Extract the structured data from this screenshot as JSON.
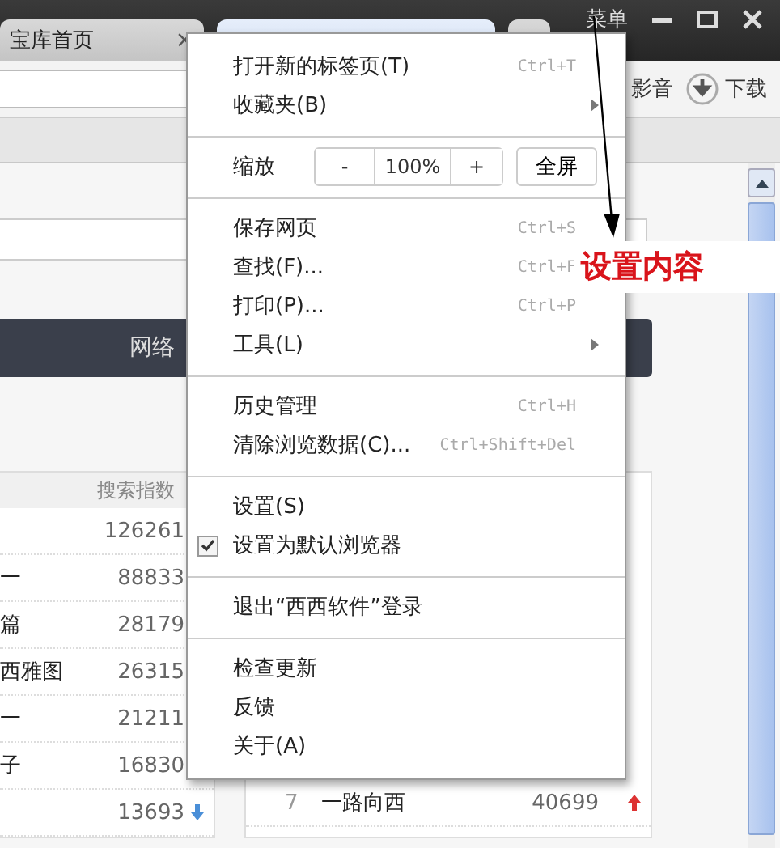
{
  "tabs": [
    {
      "title": "宝库首页",
      "close": "×",
      "selected": false
    },
    {
      "selected": true
    },
    {
      "selected": false
    }
  ],
  "menu_button": "菜单",
  "toolbar": {
    "links": [
      {
        "label": "影音",
        "kind": "text"
      },
      {
        "label": "下载",
        "kind": "download"
      }
    ]
  },
  "page": {
    "nav_bar": {
      "items": [
        "网络"
      ]
    },
    "left_table": {
      "header": "搜索指数",
      "rows": [
        {
          "name": "",
          "value": "126261"
        },
        {
          "name": "一",
          "value": "88833"
        },
        {
          "name": "篇",
          "value": "28179"
        },
        {
          "name": "西雅图",
          "value": "26315"
        },
        {
          "name": "一",
          "value": "21211"
        },
        {
          "name": "子",
          "value": "16830"
        },
        {
          "name": "",
          "value": "13693",
          "rising": false
        }
      ]
    },
    "right_table": {
      "rows": [
        {
          "rank": "7",
          "name": "一路向西",
          "value": "40699",
          "rising": true
        }
      ]
    }
  },
  "menu": {
    "items": [
      {
        "kind": "item",
        "label": "打开新的标签页(T)",
        "shortcut": "Ctrl+T"
      },
      {
        "kind": "submenu",
        "label": "收藏夹(B)"
      },
      {
        "kind": "separator"
      },
      {
        "kind": "zoom",
        "label": "缩放",
        "minus": "-",
        "value": "100%",
        "plus": "+",
        "fullscreen": "全屏"
      },
      {
        "kind": "separator"
      },
      {
        "kind": "item",
        "label": "保存网页",
        "shortcut": "Ctrl+S"
      },
      {
        "kind": "item",
        "label": "查找(F)...",
        "shortcut": "Ctrl+F"
      },
      {
        "kind": "item",
        "label": "打印(P)...",
        "shortcut": "Ctrl+P"
      },
      {
        "kind": "submenu",
        "label": "工具(L)"
      },
      {
        "kind": "separator"
      },
      {
        "kind": "item",
        "label": "历史管理",
        "shortcut": "Ctrl+H"
      },
      {
        "kind": "item",
        "label": "清除浏览数据(C)...",
        "shortcut": "Ctrl+Shift+Del"
      },
      {
        "kind": "separator"
      },
      {
        "kind": "item",
        "label": "设置(S)"
      },
      {
        "kind": "check",
        "label": "设置为默认浏览器",
        "checked": true
      },
      {
        "kind": "separator"
      },
      {
        "kind": "item",
        "label": "退出“西西软件”登录"
      },
      {
        "kind": "separator"
      },
      {
        "kind": "item",
        "label": "检查更新"
      },
      {
        "kind": "item",
        "label": "反馈"
      },
      {
        "kind": "item",
        "label": "关于(A)"
      }
    ]
  },
  "annotation": {
    "text": "设置内容"
  }
}
